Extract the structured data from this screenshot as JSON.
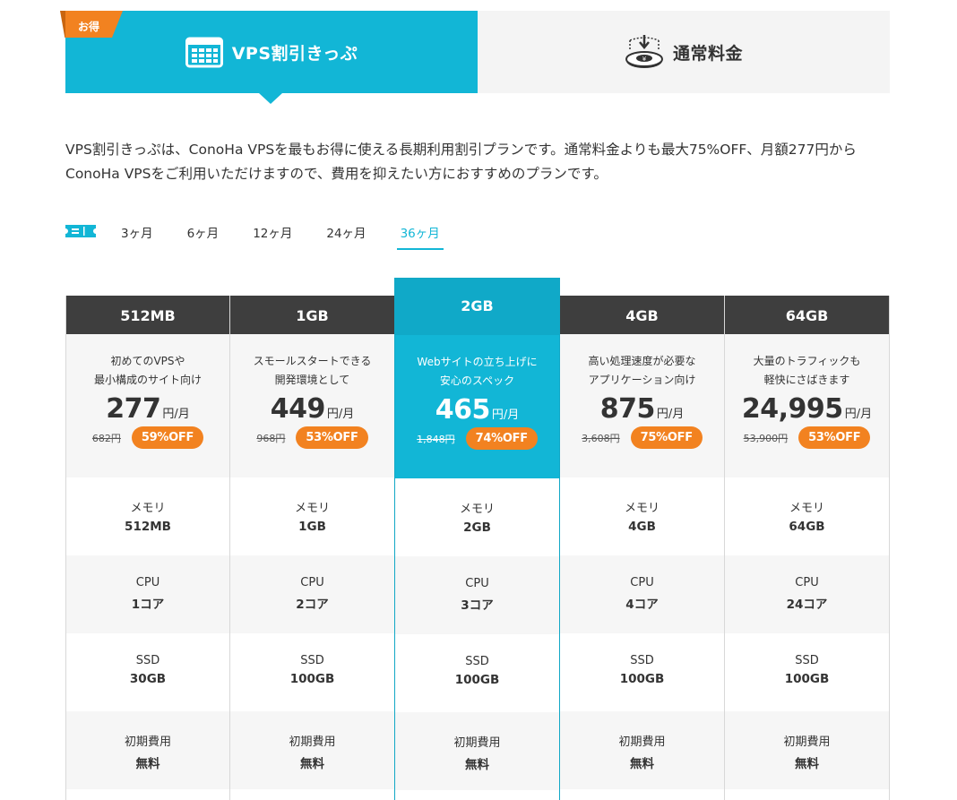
{
  "tabs": {
    "discount": {
      "label": "VPS割引きっぷ",
      "badge": "お得"
    },
    "regular": {
      "label": "通常料金"
    }
  },
  "description": "VPS割引きっぷは、ConoHa VPSを最もお得に使える長期利用割引プランです。通常料金よりも最大75%OFF、月額277円からConoHa VPSをご利用いただけますので、費用を抑えたい方におすすめのプランです。",
  "periods": {
    "items": [
      "3ヶ月",
      "6ヶ月",
      "12ヶ月",
      "24ヶ月",
      "36ヶ月"
    ],
    "selected": "36ヶ月"
  },
  "plans": [
    {
      "name": "512MB",
      "catch1": "初めてのVPSや",
      "catch2": "最小構成のサイト向け",
      "price": "277",
      "unit": "円/月",
      "old_price": "682円",
      "off": "59%OFF",
      "memory_label": "メモリ",
      "memory": "512MB",
      "cpu_label": "CPU",
      "cpu": "1コア",
      "ssd_label": "SSD",
      "ssd": "30GB",
      "fee_label": "初期費用",
      "fee": "無料"
    },
    {
      "name": "1GB",
      "catch1": "スモールスタートできる",
      "catch2": "開発環境として",
      "price": "449",
      "unit": "円/月",
      "old_price": "968円",
      "off": "53%OFF",
      "memory_label": "メモリ",
      "memory": "1GB",
      "cpu_label": "CPU",
      "cpu": "2コア",
      "ssd_label": "SSD",
      "ssd": "100GB",
      "fee_label": "初期費用",
      "fee": "無料"
    },
    {
      "name": "2GB",
      "catch1": "Webサイトの立ち上げに",
      "catch2": "安心のスペック",
      "price": "465",
      "unit": "円/月",
      "old_price": "1,848円",
      "off": "74%OFF",
      "memory_label": "メモリ",
      "memory": "2GB",
      "cpu_label": "CPU",
      "cpu": "3コア",
      "ssd_label": "SSD",
      "ssd": "100GB",
      "fee_label": "初期費用",
      "fee": "無料"
    },
    {
      "name": "4GB",
      "catch1": "高い処理速度が必要な",
      "catch2": "アプリケーション向け",
      "price": "875",
      "unit": "円/月",
      "old_price": "3,608円",
      "off": "75%OFF",
      "memory_label": "メモリ",
      "memory": "4GB",
      "cpu_label": "CPU",
      "cpu": "4コア",
      "ssd_label": "SSD",
      "ssd": "100GB",
      "fee_label": "初期費用",
      "fee": "無料"
    },
    {
      "name": "64GB",
      "catch1": "大量のトラフィックも",
      "catch2": "軽快にさばきます",
      "price": "24,995",
      "unit": "円/月",
      "old_price": "53,900円",
      "off": "53%OFF",
      "memory_label": "メモリ",
      "memory": "64GB",
      "cpu_label": "CPU",
      "cpu": "24コア",
      "ssd_label": "SSD",
      "ssd": "100GB",
      "fee_label": "初期費用",
      "fee": "無料"
    }
  ],
  "colors": {
    "accent": "#12b6d6",
    "badge": "#f28220",
    "header_dark": "#3e3e3e"
  },
  "icons": {
    "discount_tab": "calendar-icon",
    "regular_tab": "coin-deposit-icon",
    "period_bar": "ticket-icon"
  }
}
